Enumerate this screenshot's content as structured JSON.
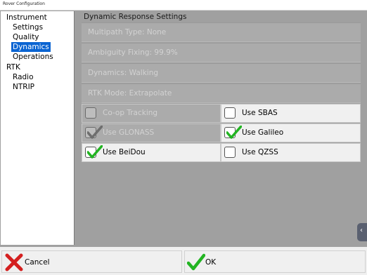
{
  "window": {
    "title": "Rover Configuration"
  },
  "nav": {
    "items": [
      {
        "label": "Instrument",
        "level": 0,
        "selected": false
      },
      {
        "label": "Settings",
        "level": 1,
        "selected": false
      },
      {
        "label": "Quality",
        "level": 1,
        "selected": false
      },
      {
        "label": "Dynamics",
        "level": 1,
        "selected": true
      },
      {
        "label": "Operations",
        "level": 1,
        "selected": false
      },
      {
        "label": "RTK",
        "level": 0,
        "selected": false
      },
      {
        "label": "Radio",
        "level": 1,
        "selected": false
      },
      {
        "label": "NTRIP",
        "level": 1,
        "selected": false
      }
    ]
  },
  "panel": {
    "title": "Dynamic Response Settings",
    "fields": [
      "Multipath Type: None",
      "Ambiguity Fixing: 99.9%",
      "Dynamics: Walking",
      "RTK Mode: Extrapolate"
    ],
    "options": [
      {
        "label": "Co-op Tracking",
        "checked": false,
        "enabled": false
      },
      {
        "label": "Use SBAS",
        "checked": false,
        "enabled": true
      },
      {
        "label": "Use GLONASS",
        "checked": true,
        "enabled": false
      },
      {
        "label": "Use Galileo",
        "checked": true,
        "enabled": true
      },
      {
        "label": "Use BeiDou",
        "checked": true,
        "enabled": true
      },
      {
        "label": "Use QZSS",
        "checked": false,
        "enabled": true
      }
    ]
  },
  "buttons": {
    "cancel": "Cancel",
    "ok": "OK"
  },
  "colors": {
    "selection": "#0a64d2",
    "check": "#22b422",
    "cancel": "#d42020",
    "disabled_bg": "#a0a0a0"
  }
}
